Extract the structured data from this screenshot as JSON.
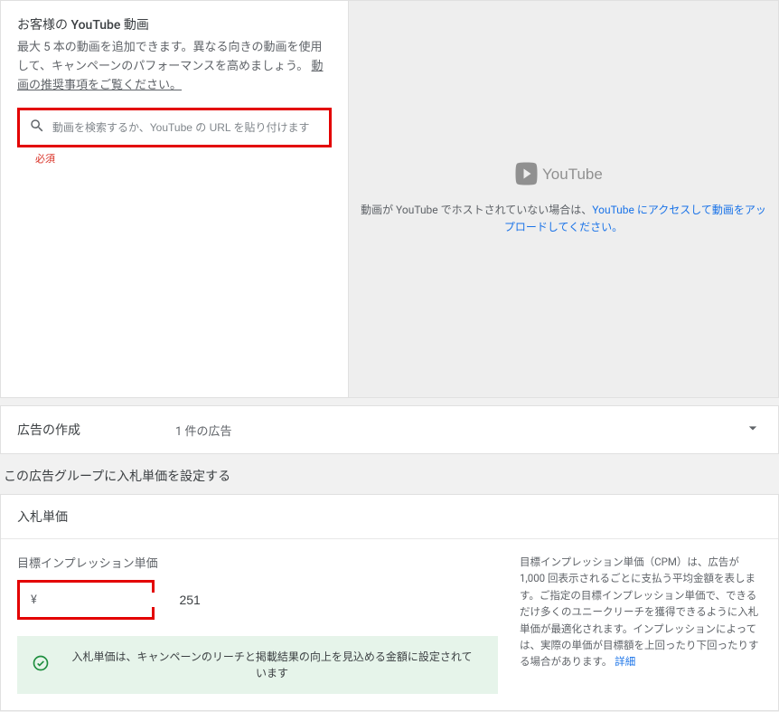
{
  "youtube_panel": {
    "title": "お客様の YouTube 動画",
    "description_prefix": "最大 5 本の動画を追加できます。異なる向きの動画を使用して、キャンペーンのパフォーマンスを高めましょう。",
    "recommendation_link_text": "動画の推奨事項をご覧ください。",
    "search_placeholder": "動画を検索するか、YouTube の URL を貼り付けます",
    "required_label": "必須"
  },
  "preview_panel": {
    "logo_text": "YouTube",
    "text_prefix": "動画が YouTube でホストされていない場合は、",
    "link_text": "YouTube にアクセスして動画をアップロードしてください。"
  },
  "ad_creation": {
    "label": "広告の作成",
    "count": "1 件の広告"
  },
  "bid_section": {
    "heading": "この広告グループに入札単価を設定する",
    "card_title": "入札単価",
    "field_label": "目標インプレッション単価",
    "currency": "¥",
    "value": "251",
    "banner_text": "入札単価は、キャンペーンのリーチと掲載結果の向上を見込める金額に設定されています",
    "help_text": "目標インプレッション単価（CPM）は、広告が 1,000 回表示されるごとに支払う平均金額を表します。ご指定の目標インプレッション単価で、できるだけ多くのユニークリーチを獲得できるように入札単価が最適化されます。インプレッションによっては、実際の単価が目標額を上回ったり下回ったりする場合があります。",
    "help_link": "詳細"
  }
}
